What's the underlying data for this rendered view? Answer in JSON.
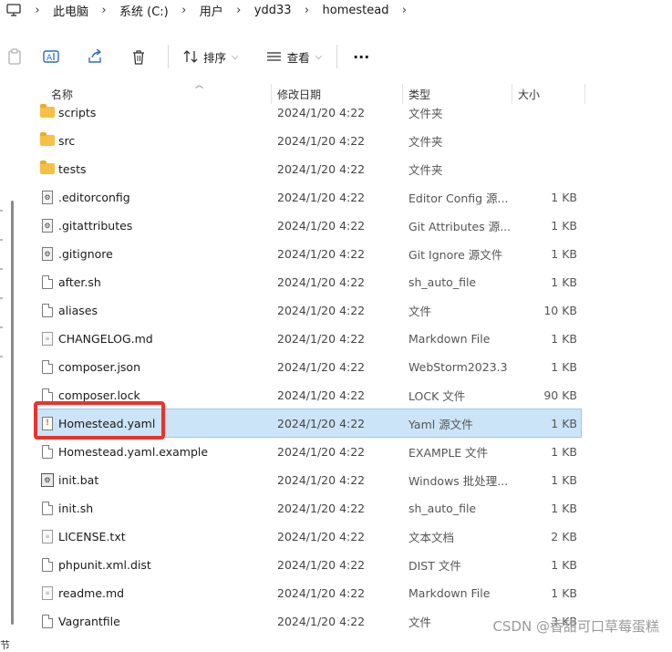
{
  "breadcrumb": {
    "items": [
      "此电脑",
      "系统 (C:)",
      "用户",
      "ydd33",
      "homestead"
    ]
  },
  "toolbar": {
    "sort_label": "排序",
    "view_label": "查看",
    "more_label": "···"
  },
  "columns": {
    "name": "名称",
    "date": "修改日期",
    "type": "类型",
    "size": "大小"
  },
  "files": [
    {
      "name": "scripts",
      "date": "2024/1/20 4:22",
      "type": "文件夹",
      "size": "",
      "icon": "folder-icon"
    },
    {
      "name": "src",
      "date": "2024/1/20 4:22",
      "type": "文件夹",
      "size": "",
      "icon": "folder-icon"
    },
    {
      "name": "tests",
      "date": "2024/1/20 4:22",
      "type": "文件夹",
      "size": "",
      "icon": "folder-icon"
    },
    {
      "name": ".editorconfig",
      "date": "2024/1/20 4:22",
      "type": "Editor Config 源...",
      "size": "1 KB",
      "icon": "config-file-icon"
    },
    {
      "name": ".gitattributes",
      "date": "2024/1/20 4:22",
      "type": "Git Attributes 源...",
      "size": "1 KB",
      "icon": "config-file-icon"
    },
    {
      "name": ".gitignore",
      "date": "2024/1/20 4:22",
      "type": "Git Ignore 源文件",
      "size": "1 KB",
      "icon": "config-file-icon"
    },
    {
      "name": "after.sh",
      "date": "2024/1/20 4:22",
      "type": "sh_auto_file",
      "size": "1 KB",
      "icon": "file-icon"
    },
    {
      "name": "aliases",
      "date": "2024/1/20 4:22",
      "type": "文件",
      "size": "10 KB",
      "icon": "file-icon"
    },
    {
      "name": "CHANGELOG.md",
      "date": "2024/1/20 4:22",
      "type": "Markdown File",
      "size": "1 KB",
      "icon": "text-file-icon"
    },
    {
      "name": "composer.json",
      "date": "2024/1/20 4:22",
      "type": "WebStorm2023.3",
      "size": "1 KB",
      "icon": "file-icon"
    },
    {
      "name": "composer.lock",
      "date": "2024/1/20 4:22",
      "type": "LOCK 文件",
      "size": "90 KB",
      "icon": "file-icon"
    },
    {
      "name": "Homestead.yaml",
      "date": "2024/1/20 4:22",
      "type": "Yaml 源文件",
      "size": "1 KB",
      "icon": "yaml-file-icon",
      "selected": true
    },
    {
      "name": "Homestead.yaml.example",
      "date": "2024/1/20 4:22",
      "type": "EXAMPLE 文件",
      "size": "1 KB",
      "icon": "file-icon"
    },
    {
      "name": "init.bat",
      "date": "2024/1/20 4:22",
      "type": "Windows 批处理...",
      "size": "1 KB",
      "icon": "batch-file-icon"
    },
    {
      "name": "init.sh",
      "date": "2024/1/20 4:22",
      "type": "sh_auto_file",
      "size": "1 KB",
      "icon": "file-icon"
    },
    {
      "name": "LICENSE.txt",
      "date": "2024/1/20 4:22",
      "type": "文本文档",
      "size": "2 KB",
      "icon": "text-file-icon"
    },
    {
      "name": "phpunit.xml.dist",
      "date": "2024/1/20 4:22",
      "type": "DIST 文件",
      "size": "1 KB",
      "icon": "file-icon"
    },
    {
      "name": "readme.md",
      "date": "2024/1/20 4:22",
      "type": "Markdown File",
      "size": "1 KB",
      "icon": "text-file-icon"
    },
    {
      "name": "Vagrantfile",
      "date": "2024/1/20 4:22",
      "type": "文件",
      "size": "3 KB",
      "icon": "file-icon"
    }
  ],
  "nav": {
    "bottom_label": "节"
  },
  "watermark": "CSDN @香甜可口草莓蛋糕",
  "colors": {
    "selection": "#cce4f7",
    "highlight": "#e8332d",
    "folder": "#f5c044"
  }
}
